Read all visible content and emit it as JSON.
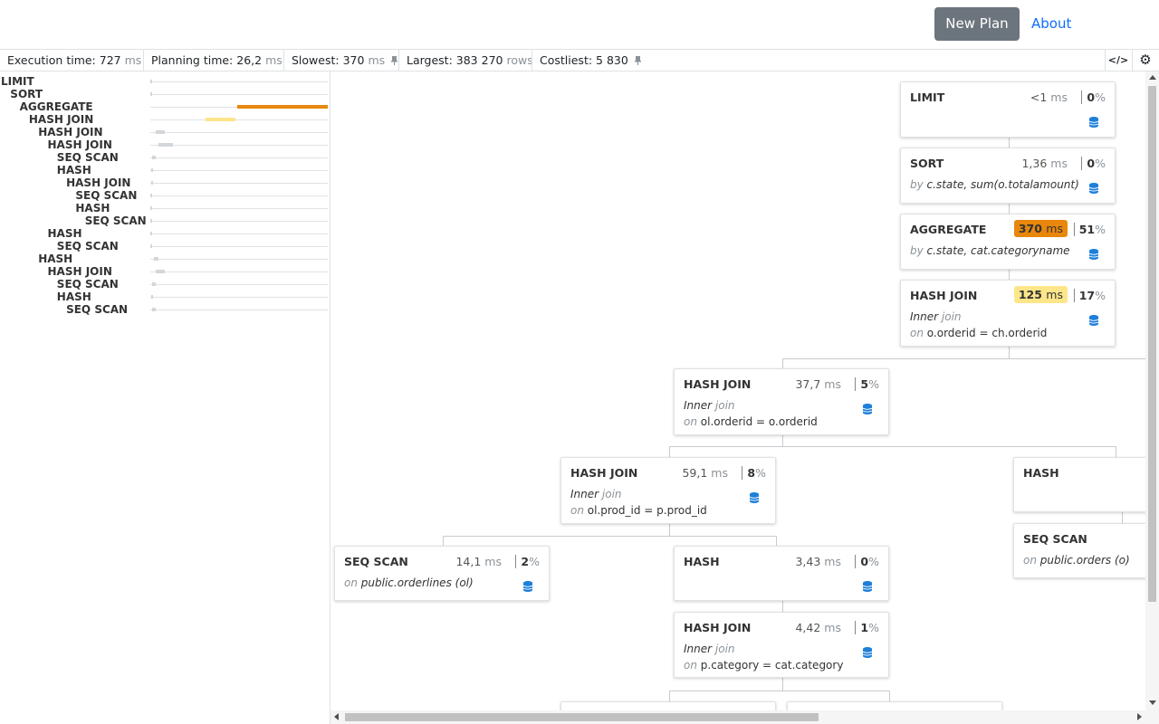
{
  "header": {
    "new_plan_label": "New Plan",
    "about_label": "About"
  },
  "stats": {
    "execution_label": "Execution time:",
    "execution_value": "727",
    "execution_unit": "ms",
    "planning_label": "Planning time:",
    "planning_value": "26,2",
    "planning_unit": "ms",
    "slowest_label": "Slowest:",
    "slowest_value": "370",
    "slowest_unit": "ms",
    "largest_label": "Largest:",
    "largest_value": "383 270",
    "largest_unit": "rows",
    "costliest_label": "Costliest:",
    "costliest_value": "5 830",
    "code_icon_glyph": "</>",
    "settings_icon_glyph": "⚙"
  },
  "tree": [
    {
      "label": "LIMIT",
      "depth": 0,
      "fraction": 0.0014
    },
    {
      "label": "SORT",
      "depth": 1,
      "fraction": 0.0019
    },
    {
      "label": "AGGREGATE",
      "depth": 2,
      "fraction": 0.51
    },
    {
      "label": "HASH JOIN",
      "depth": 3,
      "fraction": 0.17
    },
    {
      "label": "HASH JOIN",
      "depth": 4,
      "fraction": 0.05
    },
    {
      "label": "HASH JOIN",
      "depth": 5,
      "fraction": 0.08
    },
    {
      "label": "SEQ SCAN",
      "depth": 6,
      "fraction": 0.02
    },
    {
      "label": "HASH",
      "depth": 6,
      "fraction": 0.005
    },
    {
      "label": "HASH JOIN",
      "depth": 7,
      "fraction": 0.006
    },
    {
      "label": "SEQ SCAN",
      "depth": 8,
      "fraction": 0.002
    },
    {
      "label": "HASH",
      "depth": 8,
      "fraction": 0.001
    },
    {
      "label": "SEQ SCAN",
      "depth": 9,
      "fraction": 0.001
    },
    {
      "label": "HASH",
      "depth": 5,
      "fraction": 0.002
    },
    {
      "label": "SEQ SCAN",
      "depth": 6,
      "fraction": 0.003
    },
    {
      "label": "HASH",
      "depth": 4,
      "fraction": 0.03
    },
    {
      "label": "HASH JOIN",
      "depth": 5,
      "fraction": 0.05
    },
    {
      "label": "SEQ SCAN",
      "depth": 6,
      "fraction": 0.02
    },
    {
      "label": "HASH",
      "depth": 6,
      "fraction": 0.005
    },
    {
      "label": "SEQ SCAN",
      "depth": 7,
      "fraction": 0.02
    }
  ],
  "nodes": {
    "limit": {
      "title": "LIMIT",
      "time": "<1",
      "unit": "ms",
      "pct": "0",
      "pct_unit": "%"
    },
    "sort": {
      "title": "SORT",
      "time": "1,36",
      "unit": "ms",
      "pct": "0",
      "pct_unit": "%",
      "desc_key": "by",
      "desc_val": "c.state, sum(o.totalamount)"
    },
    "agg": {
      "title": "AGGREGATE",
      "time": "370",
      "unit": "ms",
      "pct": "51",
      "pct_unit": "%",
      "desc_key": "by",
      "desc_val": "c.state, cat.categoryname",
      "badge_color": "#e8870b"
    },
    "hj1": {
      "title": "HASH JOIN",
      "time": "125",
      "unit": "ms",
      "pct": "17",
      "pct_unit": "%",
      "join_type": "Inner",
      "join_word": "join",
      "on_key": "on",
      "on_val": "o.orderid = ch.orderid",
      "badge_color": "#fde68a"
    },
    "hj2": {
      "title": "HASH JOIN",
      "time": "37,7",
      "unit": "ms",
      "pct": "5",
      "pct_unit": "%",
      "join_type": "Inner",
      "join_word": "join",
      "on_key": "on",
      "on_val": "ol.orderid = o.orderid"
    },
    "hj3": {
      "title": "HASH JOIN",
      "time": "59,1",
      "unit": "ms",
      "pct": "8",
      "pct_unit": "%",
      "join_type": "Inner",
      "join_word": "join",
      "on_key": "on",
      "on_val": "ol.prod_id = p.prod_id"
    },
    "hashR": {
      "title": "HASH"
    },
    "seqOrders": {
      "title": "SEQ SCAN",
      "on_key": "on",
      "on_val": "public.orders (o)"
    },
    "seqOL": {
      "title": "SEQ SCAN",
      "time": "14,1",
      "unit": "ms",
      "pct": "2",
      "pct_unit": "%",
      "on_key": "on",
      "on_val": "public.orderlines (ol)"
    },
    "hashM": {
      "title": "HASH",
      "time": "3,43",
      "unit": "ms",
      "pct": "0",
      "pct_unit": "%"
    },
    "hj4": {
      "title": "HASH JOIN",
      "time": "4,42",
      "unit": "ms",
      "pct": "1",
      "pct_unit": "%",
      "join_type": "Inner",
      "join_word": "join",
      "on_key": "on",
      "on_val": "p.category = cat.category"
    }
  },
  "colors": {
    "slow": "#e8870b",
    "warm": "#fde68a",
    "bar_default": "#d3d6da",
    "db_icon": "#1e7fd9",
    "link": "#0d6efd"
  }
}
